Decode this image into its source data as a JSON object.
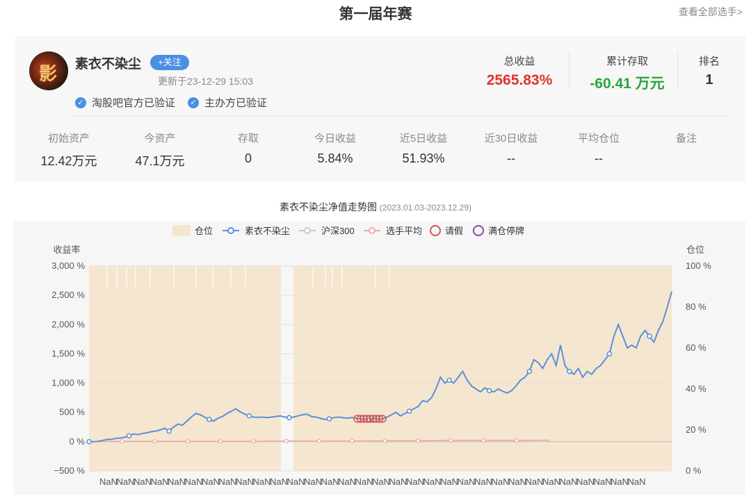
{
  "header": {
    "title": "第一届年赛",
    "view_all": "查看全部选手>"
  },
  "profile": {
    "avatar_text": "影",
    "name": "素衣不染尘",
    "follow_label": "+关注",
    "updated": "更新于23-12-29 15:03",
    "verifications": [
      "淘股吧官方已验证",
      "主办方已验证"
    ]
  },
  "summary": {
    "total_return": {
      "label": "总收益",
      "value": "2565.83%"
    },
    "cumulative_flow": {
      "label": "累计存取",
      "value": "-60.41 万元"
    },
    "rank": {
      "label": "排名",
      "value": "1"
    }
  },
  "stats": [
    {
      "label": "初始资产",
      "value": "12.42万元"
    },
    {
      "label": "今资产",
      "value": "47.1万元"
    },
    {
      "label": "存取",
      "value": "0"
    },
    {
      "label": "今日收益",
      "value": "5.84%"
    },
    {
      "label": "近5日收益",
      "value": "51.93%"
    },
    {
      "label": "近30日收益",
      "value": "--"
    },
    {
      "label": "平均仓位",
      "value": "--"
    },
    {
      "label": "备注",
      "value": ""
    }
  ],
  "colors": {
    "accent": "#4a90e2",
    "up": "#e0322c",
    "down": "#2aa53a",
    "position": "#f5e6d0",
    "user_line": "#5b8fd6",
    "avg_line": "#f0a5a5",
    "hs300_line": "#c8c8c8",
    "leave": "#d9534f",
    "full_halt": "#8e44ad"
  },
  "chart_data": {
    "type": "line",
    "title": "素衣不染尘净值走势图",
    "subtitle": "(2023.01.03-2023.12.29)",
    "legend": [
      "仓位",
      "素衣不染尘",
      "沪深300",
      "选手平均",
      "请假",
      "满仓停牌"
    ],
    "legend_placement": "top-center",
    "ylabel_left": "收益率",
    "ylabel_right": "仓位",
    "ylim_left": [
      -500,
      3000
    ],
    "ylim_right": [
      0,
      100
    ],
    "yticks_left": [
      "3,000 %",
      "2,500 %",
      "2,000 %",
      "1,500 %",
      "1,000 %",
      "500 %",
      "0 %",
      "−500 %"
    ],
    "yticks_right": [
      "100 %",
      "80 %",
      "60 %",
      "40 %",
      "20 %",
      "0 %"
    ],
    "x_tick_label": "NaN",
    "x_tick_count": 32,
    "series": [
      {
        "name": "素衣不染尘",
        "values": [
          0,
          0,
          5,
          20,
          35,
          40,
          55,
          60,
          75,
          100,
          130,
          120,
          140,
          150,
          170,
          180,
          200,
          230,
          180,
          250,
          300,
          280,
          350,
          420,
          480,
          460,
          420,
          380,
          350,
          400,
          430,
          480,
          520,
          560,
          510,
          470,
          440,
          420,
          415,
          420,
          410,
          420,
          430,
          440,
          420,
          410,
          420,
          440,
          460,
          470,
          430,
          420,
          400,
          380,
          390,
          410,
          420,
          410,
          400,
          410,
          400,
          390,
          380,
          370,
          400,
          380,
          390,
          420,
          460,
          500,
          440,
          480,
          520,
          560,
          600,
          700,
          680,
          750,
          900,
          1100,
          1000,
          1050,
          1000,
          1100,
          1200,
          1050,
          950,
          900,
          850,
          920,
          870,
          850,
          900,
          860,
          830,
          870,
          950,
          1050,
          1100,
          1200,
          1400,
          1350,
          1250,
          1400,
          1500,
          1300,
          1650,
          1300,
          1200,
          1150,
          1250,
          1100,
          1200,
          1150,
          1250,
          1300,
          1400,
          1500,
          1800,
          2000,
          1800,
          1600,
          1650,
          1600,
          1800,
          1900,
          1800,
          1700,
          1900,
          2050,
          2300,
          2565.83
        ]
      },
      {
        "name": "选手平均",
        "values": [
          0,
          5,
          5,
          5,
          5,
          5,
          10,
          10,
          10,
          15,
          15,
          20,
          20,
          20,
          25
        ]
      },
      {
        "name": "沪深300",
        "values": [
          0,
          0,
          0,
          0,
          0,
          0,
          0,
          0,
          0,
          0,
          0,
          0,
          0,
          0,
          0,
          0,
          0,
          0
        ]
      }
    ],
    "position_pct": 100,
    "leave_marker_date_index": 81
  }
}
